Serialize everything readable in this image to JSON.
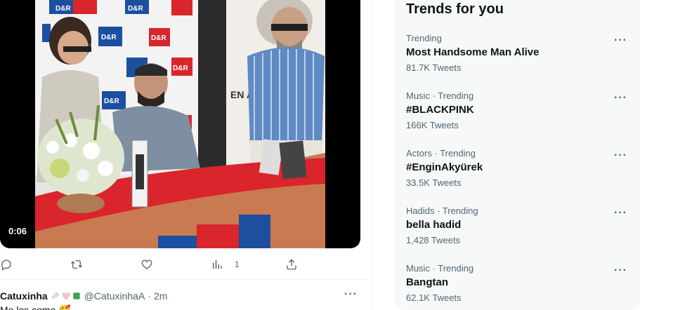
{
  "video": {
    "duration": "0:06",
    "banner_logo_text": "D&R",
    "poster_text": "EN AKY"
  },
  "actions": {
    "reply_count": "",
    "retweet_count": "",
    "like_count": "",
    "views_count": "1"
  },
  "tweet": {
    "name": "Catuxinha",
    "handle": "@CatuxinhaA",
    "separator": "·",
    "time": "2m",
    "more": "···",
    "text": "Me los come 🥰"
  },
  "trends": {
    "title": "Trends for you",
    "more": "···",
    "items": [
      {
        "context": "Trending",
        "name": "Most Handsome Man Alive",
        "count": "81.7K Tweets"
      },
      {
        "context": "Music · Trending",
        "name": "#BLACKPINK",
        "count": "166K Tweets"
      },
      {
        "context": "Actors · Trending",
        "name": "#EnginAkyürek",
        "count": "33.5K Tweets"
      },
      {
        "context": "Hadids · Trending",
        "name": "bella hadid",
        "count": "1,428 Tweets"
      },
      {
        "context": "Music · Trending",
        "name": "Bangtan",
        "count": "62.1K Tweets"
      }
    ]
  },
  "colors": {
    "accent": "#1d9bf0",
    "secondary_text": "#536471",
    "panel_bg": "#f7f9f9",
    "table_red": "#d9252b",
    "brand_blue": "#1c4fa0"
  }
}
